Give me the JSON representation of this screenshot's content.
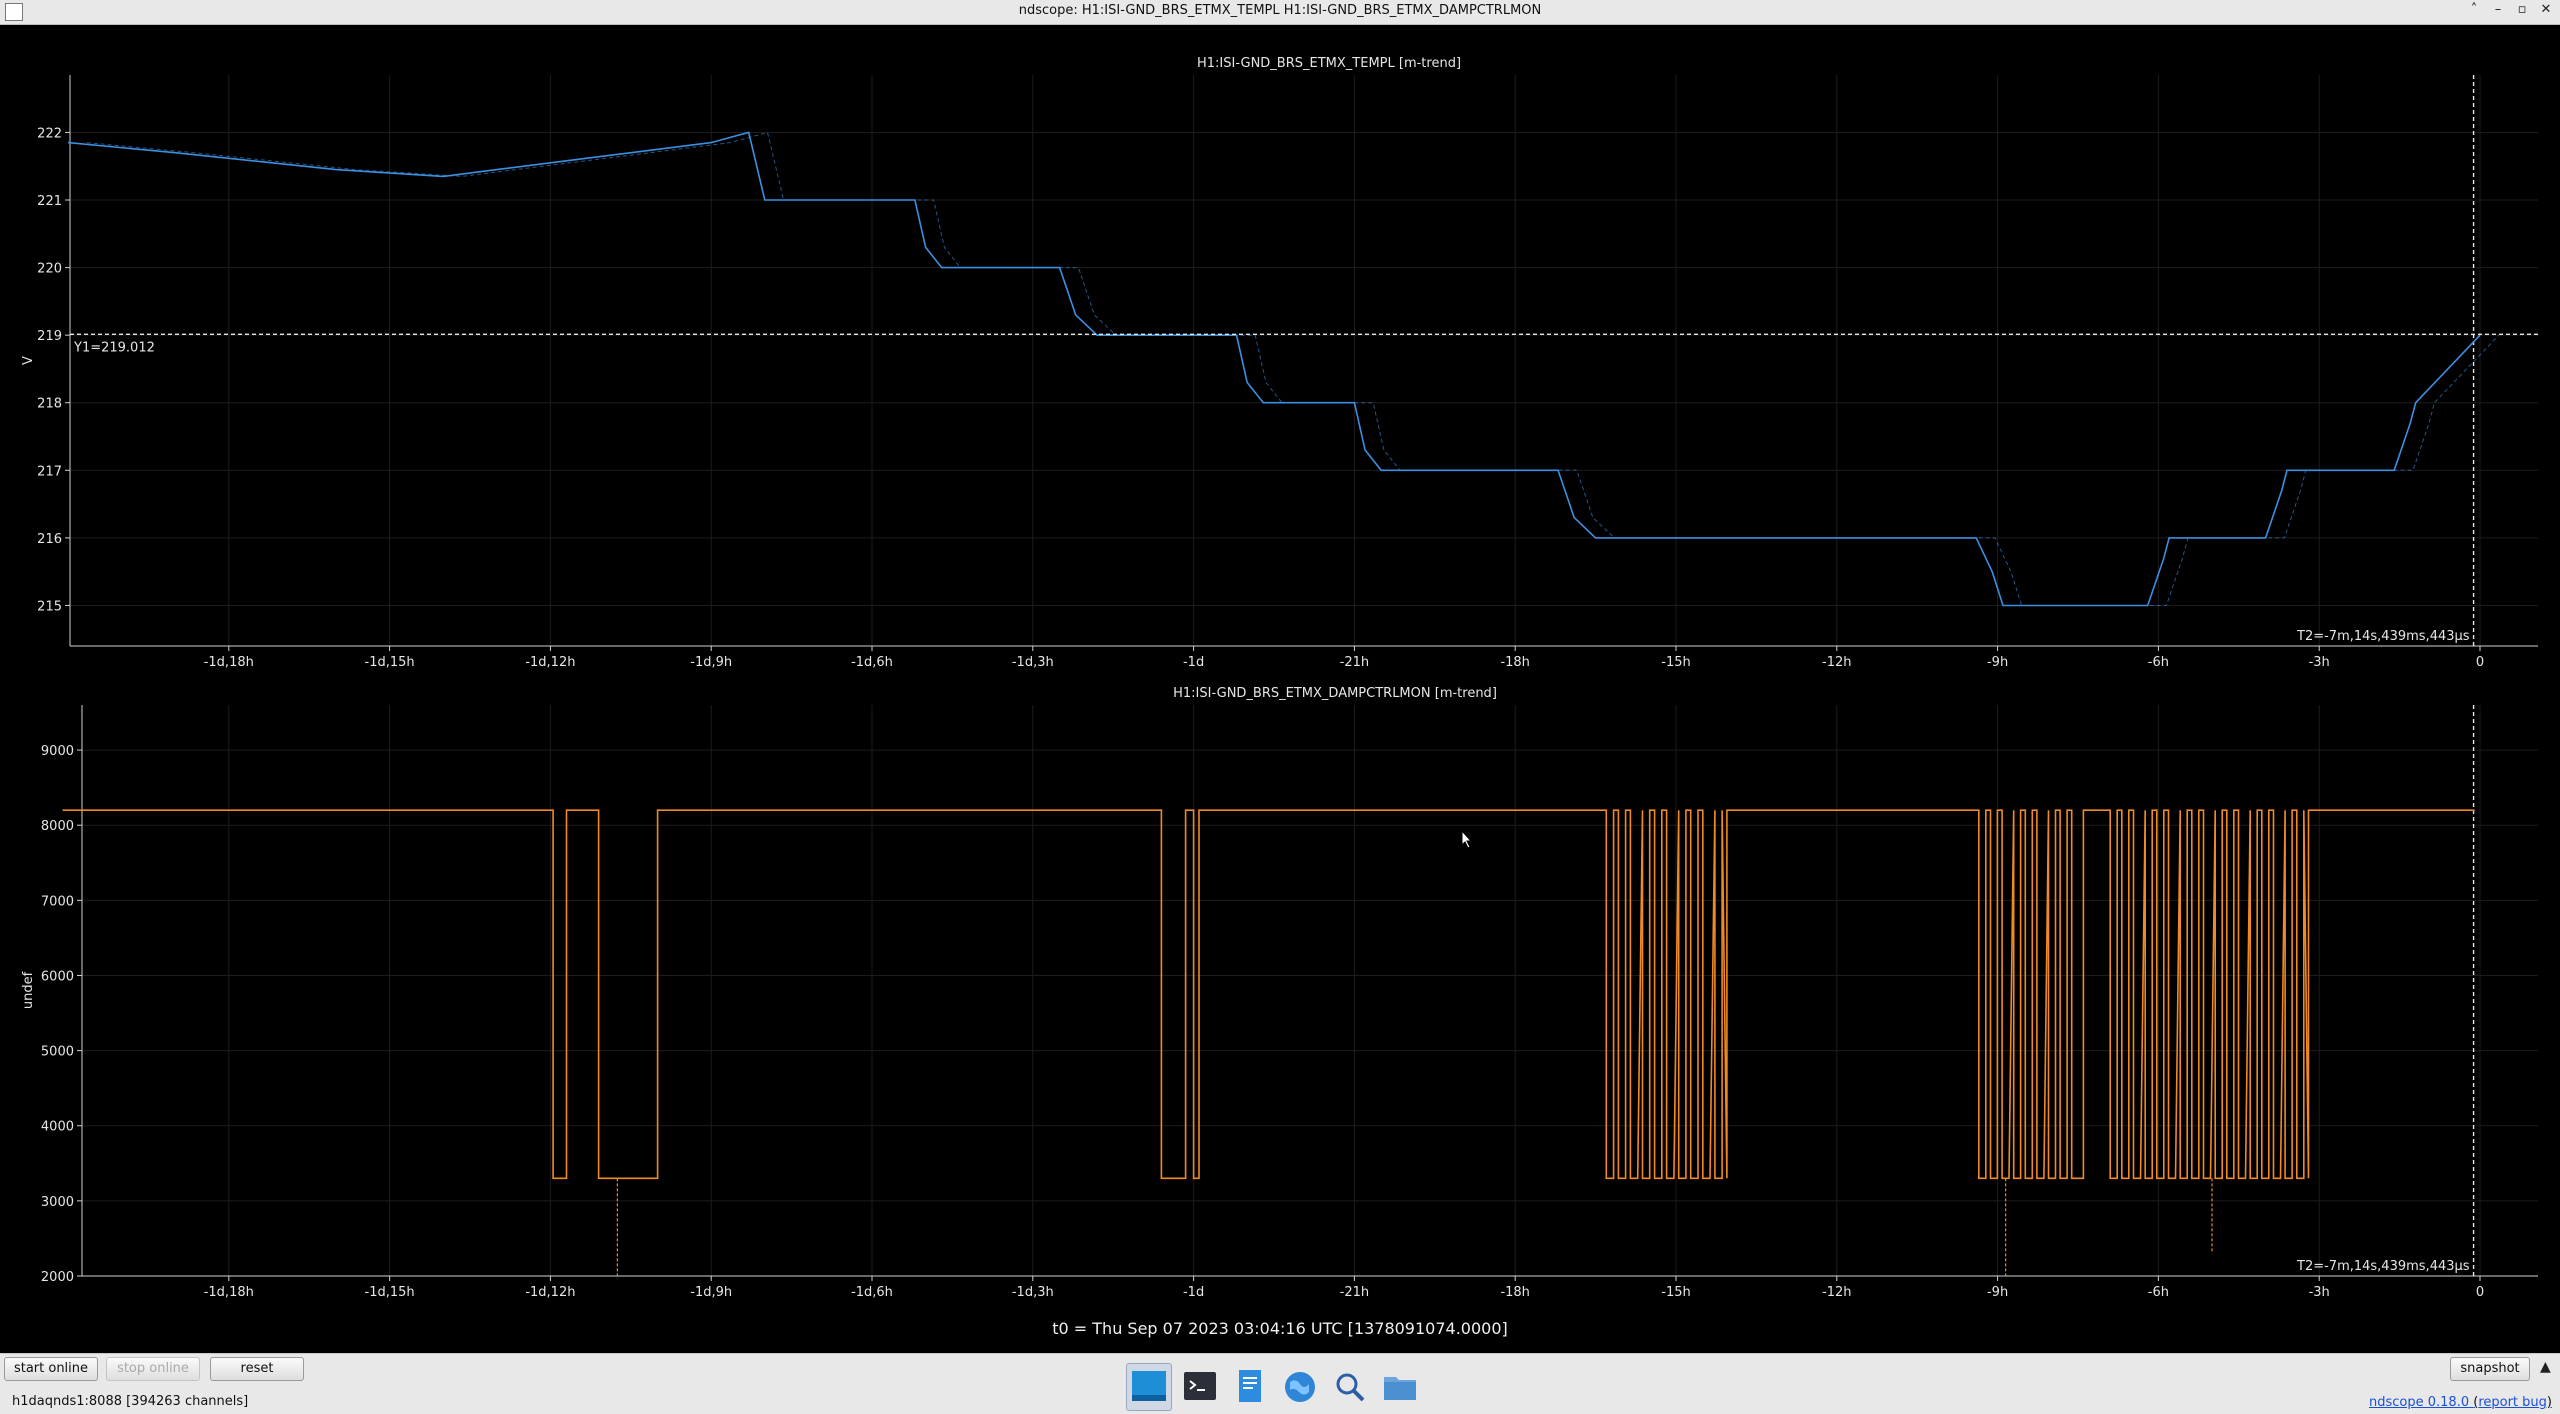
{
  "window": {
    "title": "ndscope: H1:ISI-GND_BRS_ETMX_TEMPL H1:ISI-GND_BRS_ETMX_DAMPCTRLMON"
  },
  "x_ticks": [
    "-1d,18h",
    "-1d,15h",
    "-1d,12h",
    "-1d,9h",
    "-1d,6h",
    "-1d,3h",
    "-1d",
    "-21h",
    "-18h",
    "-15h",
    "-12h",
    "-9h",
    "-6h",
    "-3h",
    "0"
  ],
  "plot1": {
    "title": "H1:ISI-GND_BRS_ETMX_TEMPL [m-trend]",
    "ylabel": "V",
    "y_ticks": [
      "222",
      "221",
      "220",
      "219",
      "218",
      "217",
      "216",
      "215"
    ],
    "cursor_y_label": "Y1=219.012",
    "cursor_y_value": 219.012,
    "t2_label": "T2=-7m,14s,439ms,443μs",
    "color": "#3d8fe0"
  },
  "plot2": {
    "title": "H1:ISI-GND_BRS_ETMX_DAMPCTRLMON [m-trend]",
    "ylabel": "undef",
    "y_ticks": [
      "9000",
      "8000",
      "7000",
      "6000",
      "5000",
      "4000",
      "3000",
      "2000"
    ],
    "t2_label": "T2=-7m,14s,439ms,443μs",
    "color": "#f08a24"
  },
  "t0_label": "t0 = Thu Sep 07 2023 03:04:16 UTC [1378091074.0000]",
  "controls": {
    "start_online": "start online",
    "stop_online": "stop online",
    "reset": "reset",
    "snapshot": "snapshot"
  },
  "status": "h1daqnds1:8088  [394263 channels]",
  "version": {
    "label": "ndscope 0.18.0",
    "report": "report bug"
  },
  "taskbar": [
    "desktop-icon",
    "terminal-icon",
    "text-editor-icon",
    "browser-icon",
    "search-icon",
    "files-icon"
  ],
  "chart_data": [
    {
      "type": "line",
      "title": "H1:ISI-GND_BRS_ETMX_TEMPL [m-trend]",
      "xlabel": "",
      "ylabel": "V",
      "x_unit": "hours relative to t0",
      "xlim": [
        -45.2,
        1.3
      ],
      "ylim": [
        214.4,
        222.85
      ],
      "grid": true,
      "series": [
        {
          "name": "H1:ISI-GND_BRS_ETMX_TEMPL",
          "x": [
            -45,
            -43,
            -40,
            -38,
            -37,
            -35,
            -33,
            -32.3,
            -32,
            -31.5,
            -31,
            -29.2,
            -29.0,
            -28.7,
            -26.5,
            -26.2,
            -25.8,
            -23.2,
            -23.0,
            -22.7,
            -21.0,
            -20.8,
            -20.5,
            -19.8,
            -17.2,
            -16.9,
            -16.5,
            -15.0,
            -9.4,
            -9.1,
            -8.9,
            -6.2,
            -5.9,
            -5.8,
            -4.0,
            -3.7,
            -3.6,
            -1.6,
            -1.3,
            -1.2,
            0
          ],
          "y": [
            221.85,
            221.7,
            221.45,
            221.35,
            221.45,
            221.65,
            221.85,
            222.0,
            221.0,
            221.0,
            221.0,
            221.0,
            220.3,
            220.0,
            220.0,
            219.3,
            219.0,
            219.0,
            218.3,
            218.0,
            218.0,
            217.3,
            217.0,
            217.0,
            217.0,
            216.3,
            216.0,
            216.0,
            216.0,
            215.5,
            215.0,
            215.0,
            215.7,
            216.0,
            216.0,
            216.7,
            217.0,
            217.0,
            217.7,
            218.0,
            219.0
          ]
        }
      ]
    },
    {
      "type": "line",
      "title": "H1:ISI-GND_BRS_ETMX_DAMPCTRLMON [m-trend]",
      "xlabel": "",
      "ylabel": "undef",
      "x_unit": "hours relative to t0",
      "xlim": [
        -45.2,
        1.3
      ],
      "ylim": [
        2000,
        9600
      ],
      "grid": true,
      "high_level": 8200,
      "low_level": 3300,
      "low_intervals": [
        [
          -35.95,
          -35.7
        ],
        [
          -35.1,
          -34.0
        ],
        [
          -24.6,
          -24.15
        ],
        [
          -24.0,
          -23.9
        ],
        [
          -16.3,
          -14.05
        ],
        [
          -9.35,
          -7.4
        ],
        [
          -6.9,
          -3.2
        ]
      ],
      "spikes": [
        [
          -34.75,
          2000
        ],
        [
          -8.85,
          2000
        ],
        [
          -5.0,
          2300
        ]
      ]
    }
  ]
}
